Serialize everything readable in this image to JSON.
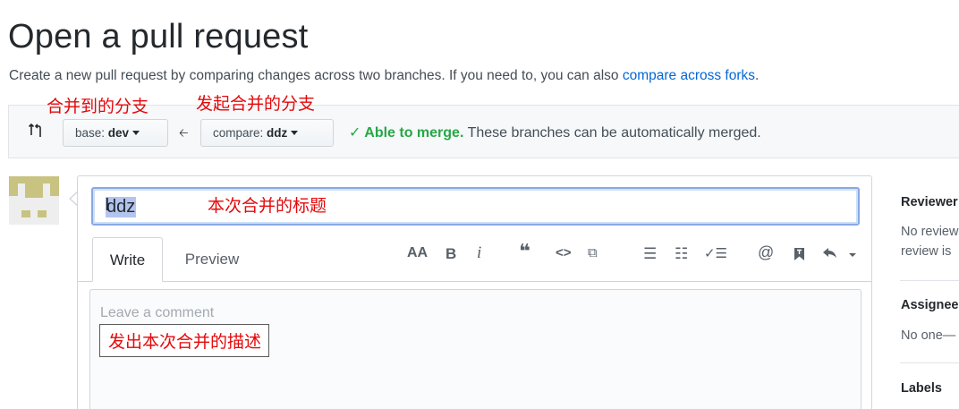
{
  "header": {
    "title": "Open a pull request",
    "subtitle": "Create a new pull request by comparing changes across two branches. If you need to, you can also ",
    "subtitle_link": "compare across forks",
    "subtitle_end": "."
  },
  "annotations": {
    "base_branch": "合并到的分支",
    "compare_branch": "发起合并的分支",
    "title": "本次合并的标题",
    "description": "发出本次合并的描述"
  },
  "range": {
    "base_prefix": "base: ",
    "base_branch": "dev",
    "compare_prefix": "compare: ",
    "compare_branch": "ddz",
    "status_ok": "Able to merge.",
    "status_text": " These branches can be automatically merged."
  },
  "form": {
    "title_value": "ddz",
    "tabs": [
      "Write",
      "Preview"
    ],
    "comment_placeholder": "Leave a comment"
  },
  "toolbar": {
    "header": "AA",
    "bold": "B",
    "italic": "i",
    "quote": "❝",
    "code": "<>",
    "link": "⧉",
    "bulleted_list": "☰",
    "numbered_list": "☷",
    "task_list": "✓☰",
    "mention": "@",
    "saved_reply": "bookmark",
    "reply": "reply"
  },
  "sidebar": {
    "reviewers": {
      "label": "Reviewer",
      "text_line1": "No review",
      "text_line2": "review is"
    },
    "assignees": {
      "label": "Assignee",
      "text": "No one—"
    },
    "labels": {
      "label": "Labels"
    }
  },
  "colors": {
    "annotation": "#e4080a",
    "link": "#0366d6",
    "success": "#28a745",
    "title_focus": "#8aa8e6"
  }
}
